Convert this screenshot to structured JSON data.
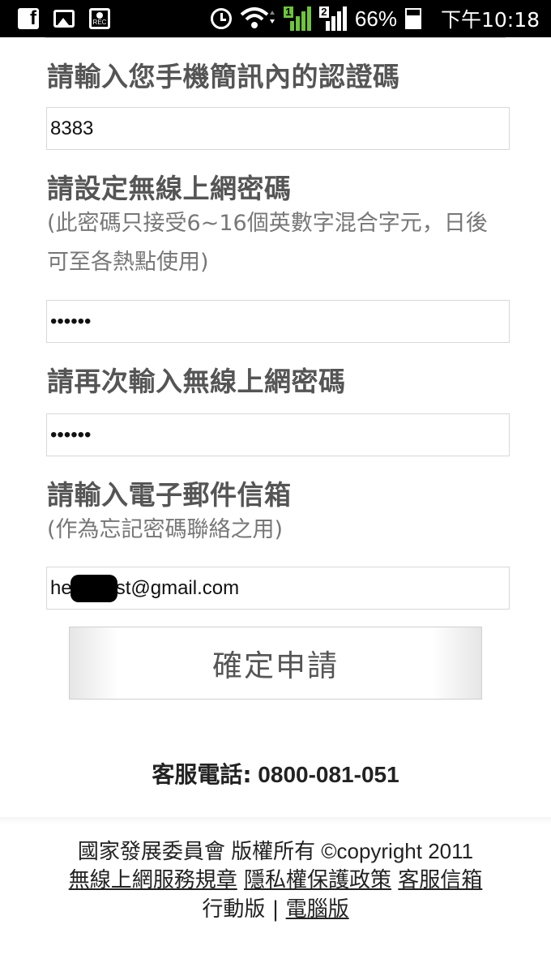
{
  "status_bar": {
    "battery_percent": "66%",
    "battery_level": 0.66,
    "time": "下午10:18",
    "sim1_label": "1",
    "sim2_label": "2",
    "rec_label": "REC",
    "icons": [
      "facebook-icon",
      "image-icon",
      "rec-icon",
      "alarm-icon",
      "wifi-icon",
      "signal-icon",
      "battery-icon"
    ]
  },
  "form": {
    "verify_label": "請輸入您手機簡訊內的認證碼",
    "verify_value": "8383",
    "password_label": "請設定無線上網密碼",
    "password_hint": "(此密碼只接受6~16個英數字混合字元，日後可至各熱點使用)",
    "password_value": "••••••",
    "confirm_label": "請再次輸入無線上網密碼",
    "confirm_value": "••••••",
    "email_label": "請輸入電子郵件信箱",
    "email_hint": "(作為忘記密碼聯絡之用)",
    "email_value_prefix": "he",
    "email_value_suffix": "st@gmail.com",
    "submit_label": "確定申請"
  },
  "service": {
    "label": "客服電話:",
    "phone": "0800-081-051"
  },
  "footer": {
    "copyright": "國家發展委員會 版權所有 ©copyright 2011",
    "links": [
      "無線上網服務規章",
      "隱私權保護政策",
      "客服信箱"
    ],
    "mobile_label": "行動版",
    "separator": "|",
    "desktop_label": "電腦版"
  }
}
